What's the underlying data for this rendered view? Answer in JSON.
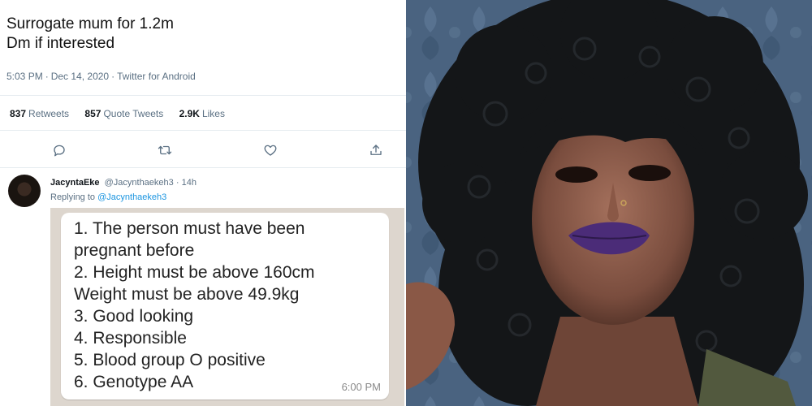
{
  "tweet": {
    "text_lines": [
      "Surrogate mum for 1.2m",
      "Dm if interested"
    ],
    "time": "5:03 PM",
    "date": "Dec 14, 2020",
    "source": "Twitter for Android",
    "retweets_count": "837",
    "retweets_label": "Retweets",
    "quote_count": "857",
    "quote_label": "Quote Tweets",
    "likes_count": "2.9K",
    "likes_label": "Likes"
  },
  "reply": {
    "display_name": "JacyntaEke",
    "handle": "@Jacynthaekeh3",
    "age": "14h",
    "replying_prefix": "Replying to",
    "replying_handle": "@Jacynthaekeh3"
  },
  "chat_message": {
    "lines": [
      "1. The person must have been",
      "pregnant before",
      "2. Height must be above 160cm",
      "Weight must be above 49.9kg",
      "3. Good looking",
      "4. Responsible",
      "5. Blood group O positive",
      "6. Genotype AA"
    ],
    "time": "6:00 PM"
  },
  "colors": {
    "secondary_text": "#5b7083",
    "link": "#1b95e0",
    "chat_background": "#ddd6ce",
    "photo_wallpaper": "#4a6380",
    "lipstick": "#4b2c78"
  },
  "icons": [
    "reply-icon",
    "retweet-icon",
    "like-icon",
    "share-icon"
  ]
}
